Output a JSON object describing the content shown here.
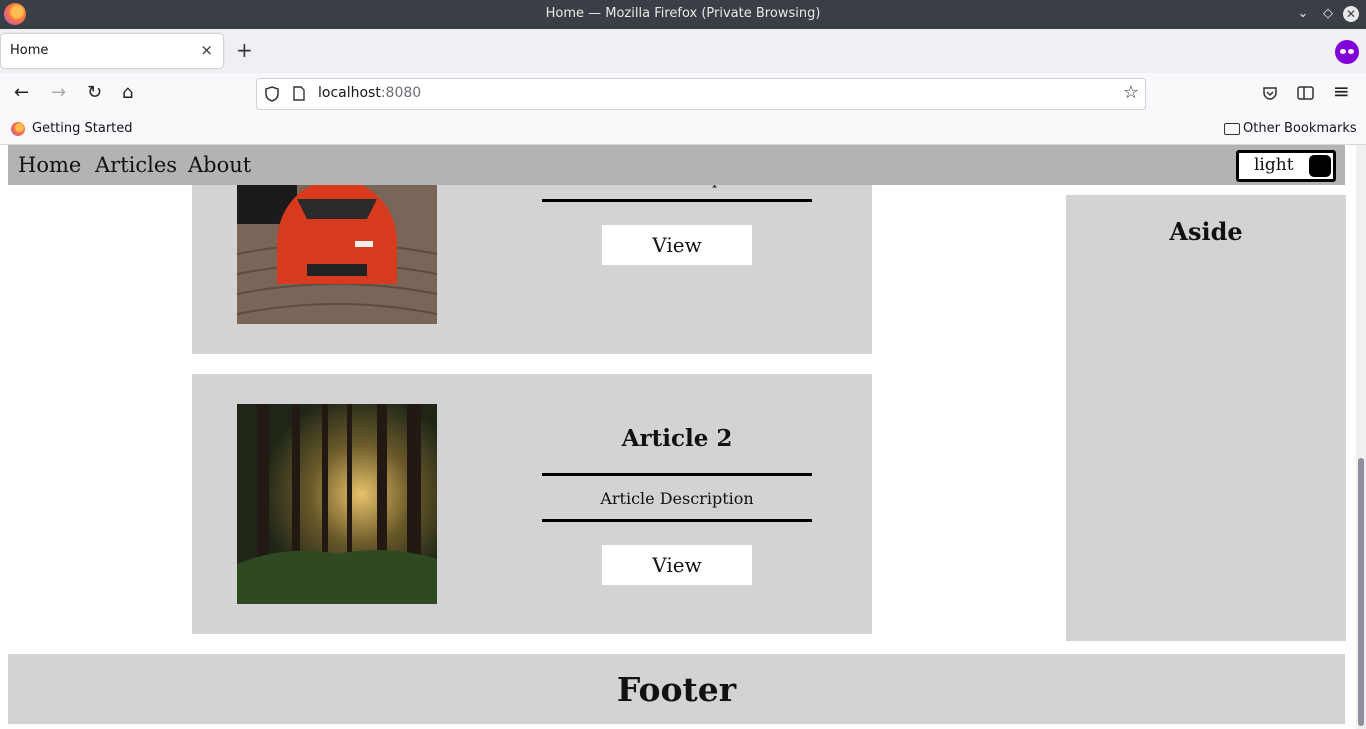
{
  "window": {
    "title": "Home — Mozilla Firefox (Private Browsing)"
  },
  "tab": {
    "title": "Home",
    "close": "×"
  },
  "toolbar": {
    "url_host": "localhost",
    "url_port": ":8080"
  },
  "bookmarks": {
    "getting_started": "Getting Started",
    "other": "Other Bookmarks"
  },
  "site": {
    "nav": [
      "Home",
      "Articles",
      "About"
    ],
    "theme_label": "light"
  },
  "articles": [
    {
      "title": "",
      "description": "Article Description",
      "button": "View",
      "image": "red-sports-car"
    },
    {
      "title": "Article 2",
      "description": "Article Description",
      "button": "View",
      "image": "forest"
    }
  ],
  "aside": {
    "title": "Aside"
  },
  "footer": {
    "title": "Footer"
  },
  "icons": {
    "back": "←",
    "forward": "→",
    "reload": "↻",
    "home": "⌂",
    "star": "☆",
    "new_tab": "+",
    "minimize": "⌄",
    "maximize": "◇",
    "close": "✕",
    "menu": "≡"
  },
  "colors": {
    "nav_bg": "#b3b3b3",
    "card_bg": "#d3d3d3",
    "private_purple": "#8000d7"
  }
}
